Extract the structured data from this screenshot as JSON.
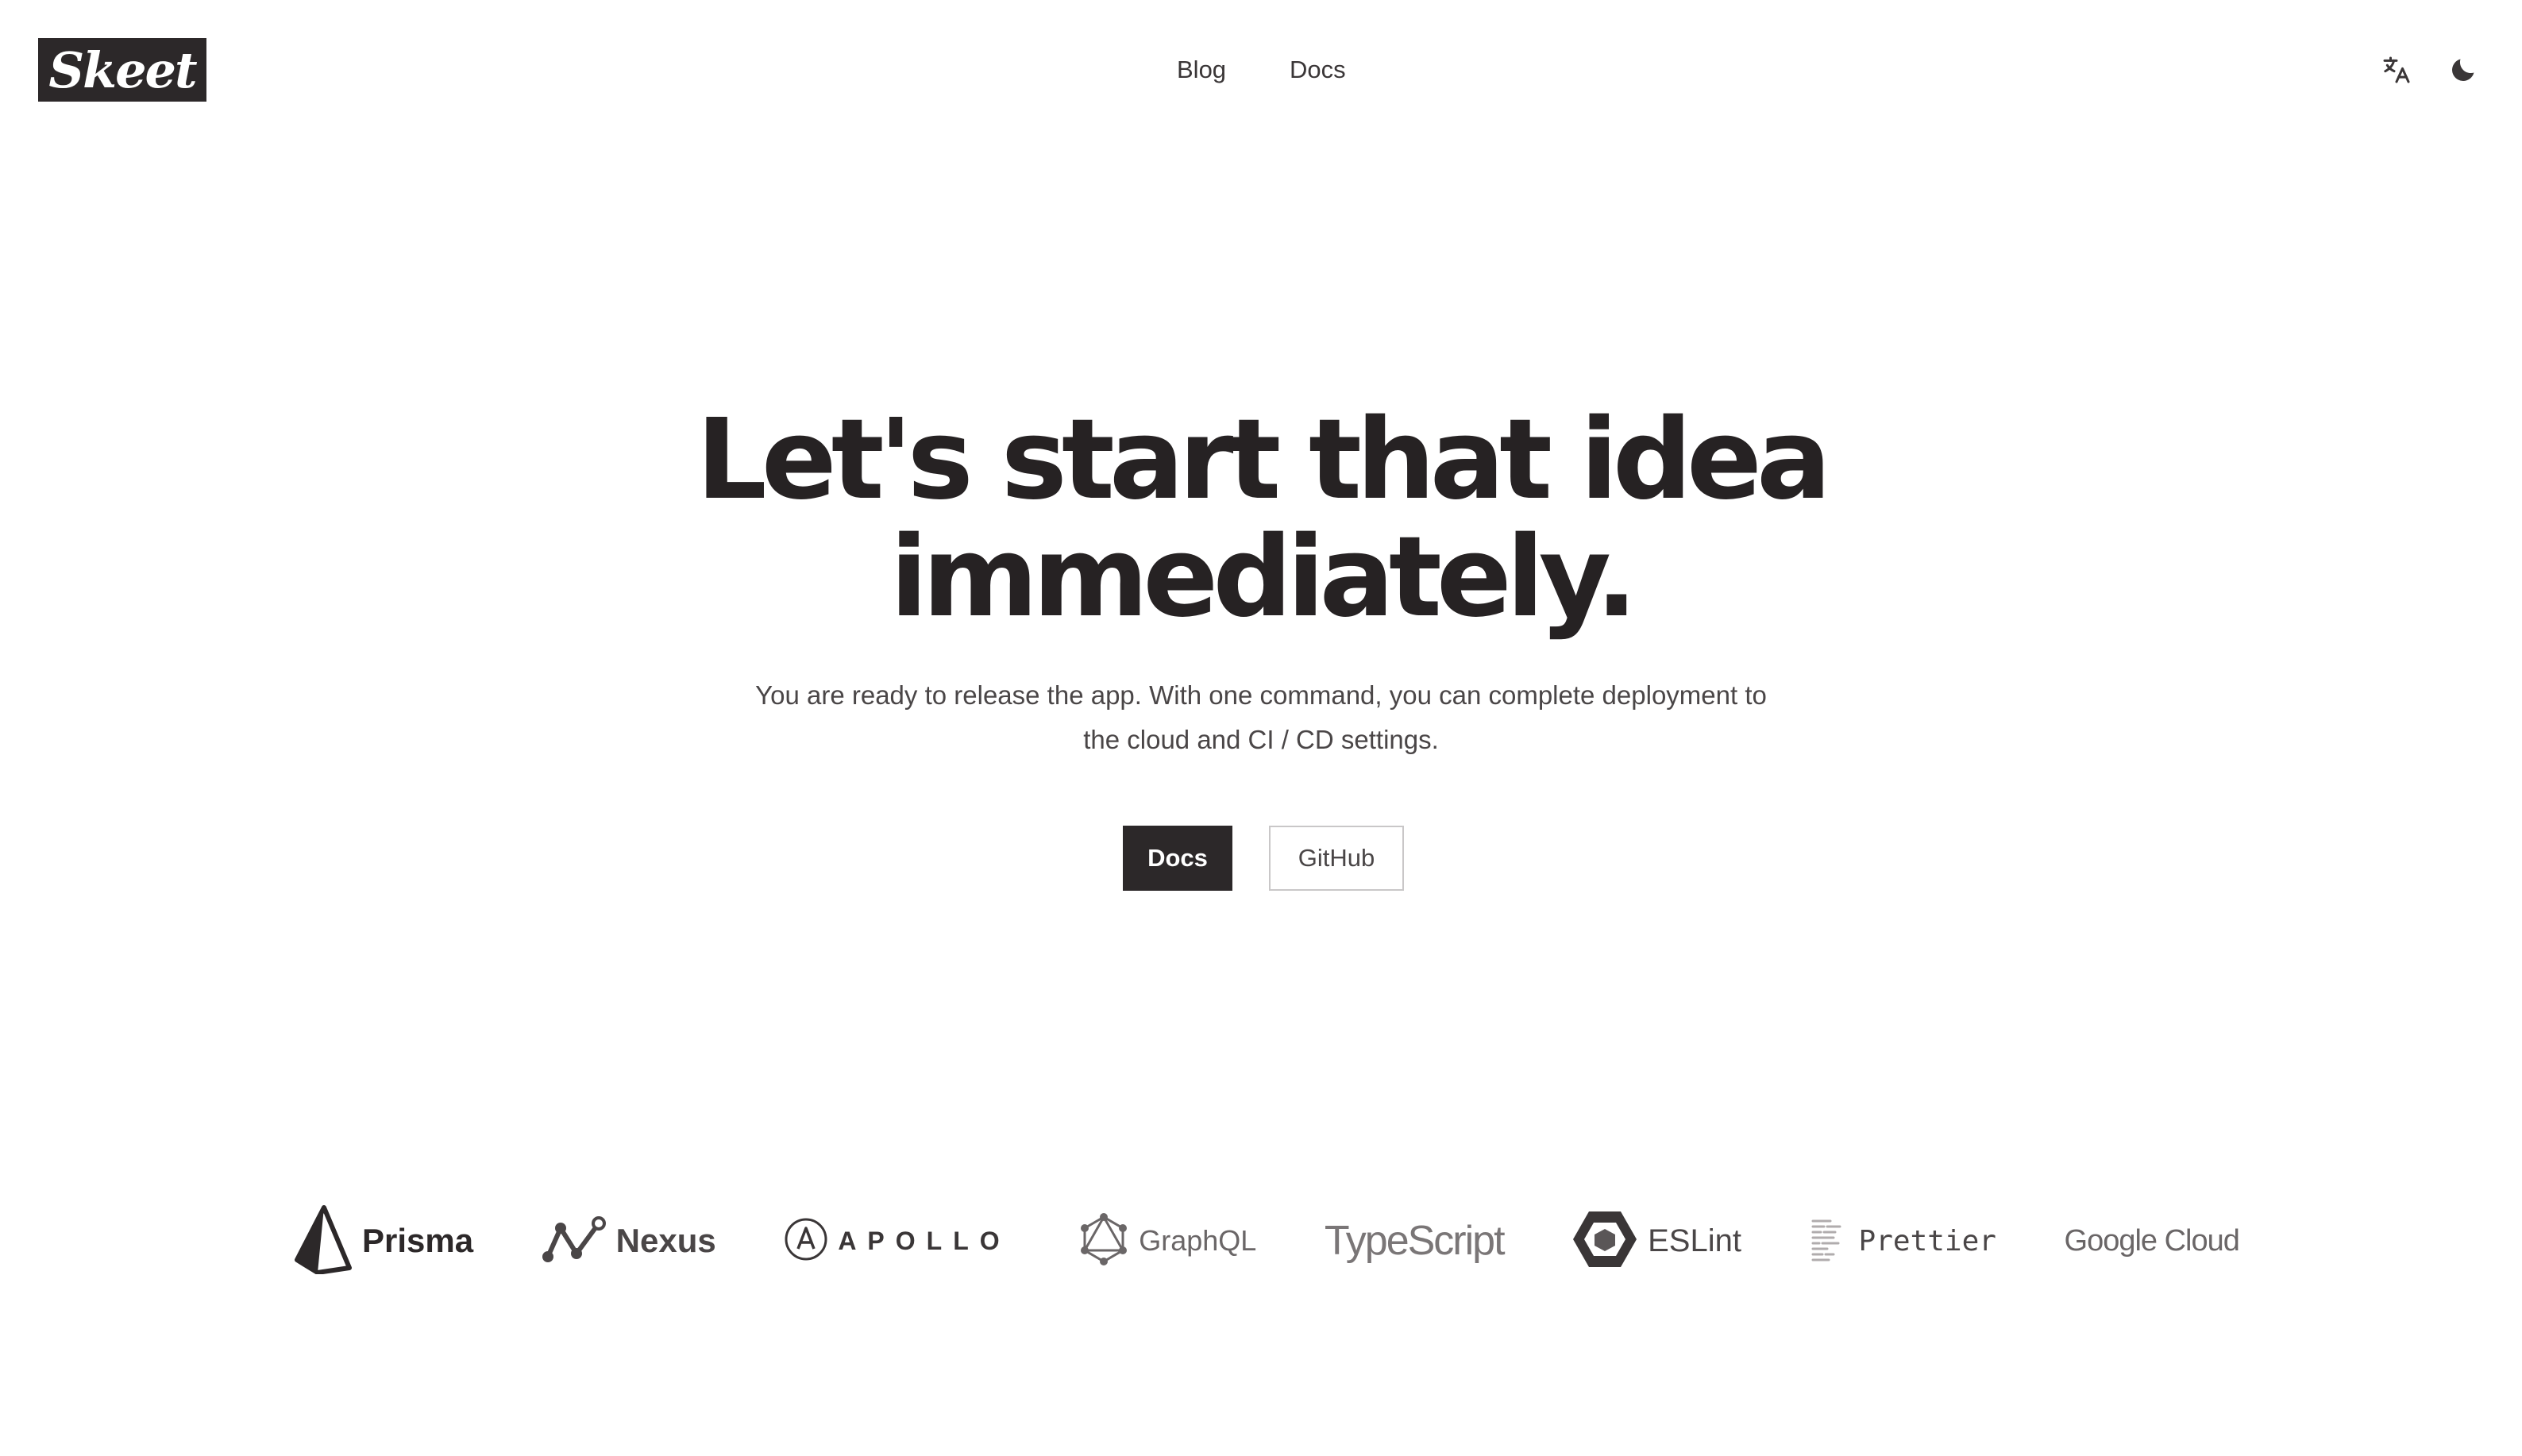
{
  "header": {
    "logo_text": "Skeet",
    "nav": [
      {
        "label": "Blog"
      },
      {
        "label": "Docs"
      }
    ],
    "icons": [
      "translate-icon",
      "moon-icon"
    ]
  },
  "hero": {
    "title_line1": "Let's start that idea",
    "title_line2": "immediately.",
    "subtitle_line1": "You are ready to release the app. With one command, you can complete deployment to",
    "subtitle_line2": "the cloud and CI / CD settings.",
    "primary_button": "Docs",
    "secondary_button": "GitHub"
  },
  "logos": [
    {
      "name": "Prisma",
      "icon": "prisma-icon"
    },
    {
      "name": "Nexus",
      "icon": "nexus-icon"
    },
    {
      "name": "APOLLO",
      "icon": "apollo-icon"
    },
    {
      "name": "GraphQL",
      "icon": "graphql-icon"
    },
    {
      "name": "TypeScript",
      "icon": ""
    },
    {
      "name": "ESLint",
      "icon": "eslint-icon"
    },
    {
      "name": "Prettier",
      "icon": "prettier-icon"
    },
    {
      "name": "Google Cloud",
      "icon": ""
    }
  ],
  "colors": {
    "dark": "#2c2829",
    "text": "#4a4647",
    "background": "#ffffff",
    "button_border": "#c9c7c8"
  }
}
